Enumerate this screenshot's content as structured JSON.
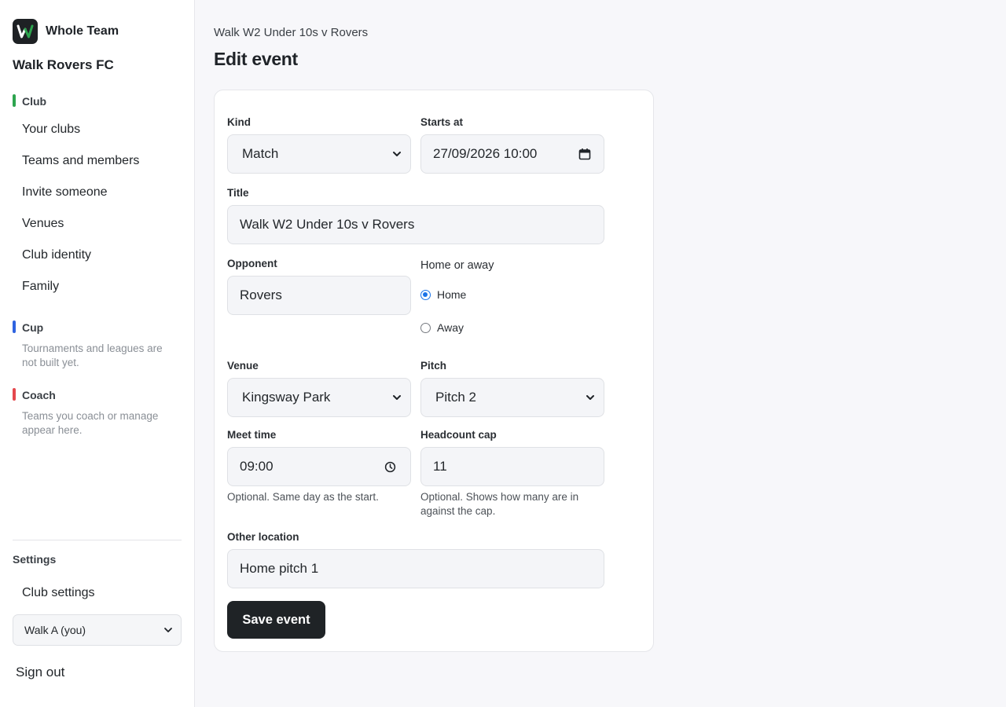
{
  "sidebar": {
    "brand_name": "Whole Team",
    "club_name": "Walk Rovers FC",
    "sections": {
      "club": {
        "label": "Club",
        "color": "#2da44e"
      },
      "cup": {
        "label": "Cup",
        "color": "#2f63e0",
        "note": "Tournaments and leagues are not built yet."
      },
      "coach": {
        "label": "Coach",
        "color": "#e5484d",
        "note": "Teams you coach or manage appear here."
      }
    },
    "club_items": [
      "Your clubs",
      "Teams and members",
      "Invite someone",
      "Venues",
      "Club identity",
      "Family"
    ],
    "settings_label": "Settings",
    "club_settings": "Club settings",
    "member_select": "Walk A (you)",
    "sign_out": "Sign out"
  },
  "main": {
    "breadcrumb": "Walk W2 Under 10s v Rovers",
    "title": "Edit event"
  },
  "form": {
    "kind": {
      "label": "Kind",
      "value": "Match"
    },
    "starts_at": {
      "label": "Starts at",
      "value": "27/09/2026 10:00"
    },
    "title": {
      "label": "Title",
      "value": "Walk W2 Under 10s v Rovers"
    },
    "opponent": {
      "label": "Opponent",
      "value": "Rovers"
    },
    "home_away": {
      "label": "Home or away",
      "options": [
        "Home",
        "Away"
      ],
      "selected": "Home"
    },
    "venue": {
      "label": "Venue",
      "value": "Kingsway Park"
    },
    "pitch": {
      "label": "Pitch",
      "value": "Pitch 2"
    },
    "meet_time": {
      "label": "Meet time",
      "value": "09:00",
      "help": "Optional. Same day as the start."
    },
    "headcount_cap": {
      "label": "Headcount cap",
      "value": "11",
      "help": "Optional. Shows how many are in against the cap."
    },
    "other_location": {
      "label": "Other location",
      "value": "Home pitch 1"
    },
    "save_label": "Save event"
  }
}
